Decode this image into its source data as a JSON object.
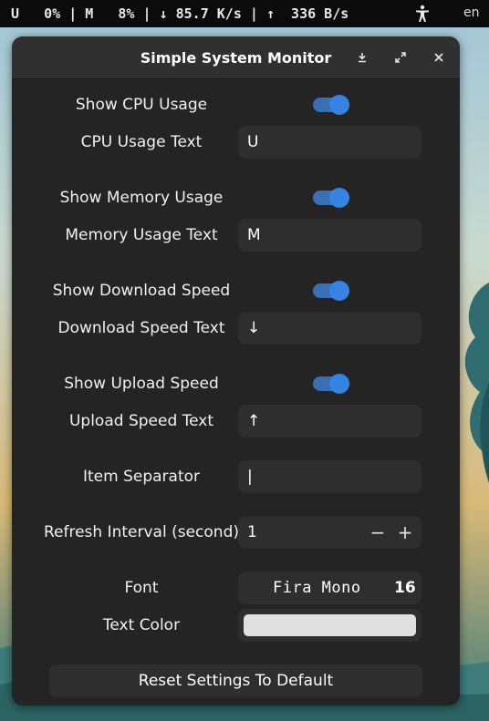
{
  "topbar": {
    "monitor_text": "U   0% | M   8% | ↓ 85.7 K/s | ↑  336 B/s",
    "language": "en",
    "accessibility_icon": "accessibility-icon"
  },
  "window": {
    "title": "Simple System Monitor",
    "minimize_icon": "minimize-icon",
    "maximize_icon": "maximize-icon",
    "close_icon": "close-icon"
  },
  "settings": {
    "show_cpu_label": "Show CPU Usage",
    "show_cpu_enabled": true,
    "cpu_text_label": "CPU Usage Text",
    "cpu_text_value": "U",
    "show_memory_label": "Show Memory Usage",
    "show_memory_enabled": true,
    "memory_text_label": "Memory Usage Text",
    "memory_text_value": "M",
    "show_download_label": "Show Download Speed",
    "show_download_enabled": true,
    "download_text_label": "Download Speed Text",
    "download_text_value": "↓",
    "show_upload_label": "Show Upload Speed",
    "show_upload_enabled": true,
    "upload_text_label": "Upload Speed Text",
    "upload_text_value": "↑",
    "separator_label": "Item Separator",
    "separator_value": "|",
    "refresh_label": "Refresh Interval (second)",
    "refresh_value": "1",
    "refresh_minus": "−",
    "refresh_plus": "+",
    "font_label": "Font",
    "font_name": "Fira Mono",
    "font_size": "16",
    "text_color_label": "Text Color",
    "text_color_value": "#e0e0e0",
    "reset_label": "Reset Settings To Default"
  },
  "colors": {
    "accent": "#3584e4",
    "window_bg": "#242424",
    "entry_bg": "#2e2e2e"
  }
}
